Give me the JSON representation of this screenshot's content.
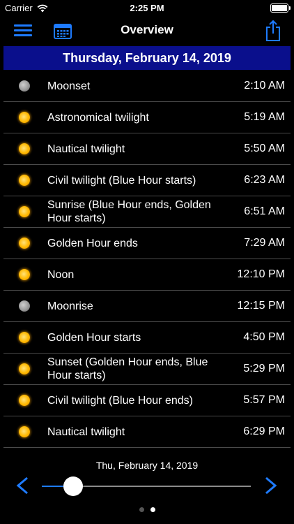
{
  "status_bar": {
    "carrier": "Carrier",
    "time": "2:25 PM"
  },
  "nav": {
    "title": "Overview"
  },
  "date_header": "Thursday, February 14, 2019",
  "events": [
    {
      "icon": "moon-icon",
      "label": "Moonset",
      "time": "2:10 AM"
    },
    {
      "icon": "sun-icon",
      "label": "Astronomical twilight",
      "time": "5:19 AM"
    },
    {
      "icon": "sun-icon",
      "label": "Nautical twilight",
      "time": "5:50 AM"
    },
    {
      "icon": "sun-icon",
      "label": "Civil twilight (Blue Hour starts)",
      "time": "6:23 AM"
    },
    {
      "icon": "sun-icon",
      "label": "Sunrise (Blue Hour ends, Golden Hour starts)",
      "time": "6:51 AM"
    },
    {
      "icon": "sun-icon",
      "label": "Golden Hour ends",
      "time": "7:29 AM"
    },
    {
      "icon": "sun-icon",
      "label": "Noon",
      "time": "12:10 PM"
    },
    {
      "icon": "moon-icon",
      "label": "Moonrise",
      "time": "12:15 PM"
    },
    {
      "icon": "sun-icon",
      "label": "Golden Hour starts",
      "time": "4:50 PM"
    },
    {
      "icon": "sun-icon",
      "label": "Sunset (Golden Hour ends, Blue Hour starts)",
      "time": "5:29 PM"
    },
    {
      "icon": "sun-icon",
      "label": "Civil twilight (Blue Hour ends)",
      "time": "5:57 PM"
    },
    {
      "icon": "sun-icon",
      "label": "Nautical twilight",
      "time": "6:29 PM"
    }
  ],
  "footer": {
    "date": "Thu, February 14, 2019",
    "slider_fraction": 0.15,
    "page_count": 2,
    "active_page": 2
  },
  "colors": {
    "accent": "#1e7bff",
    "header_bg": "#0a0f8c",
    "background": "#000000"
  }
}
